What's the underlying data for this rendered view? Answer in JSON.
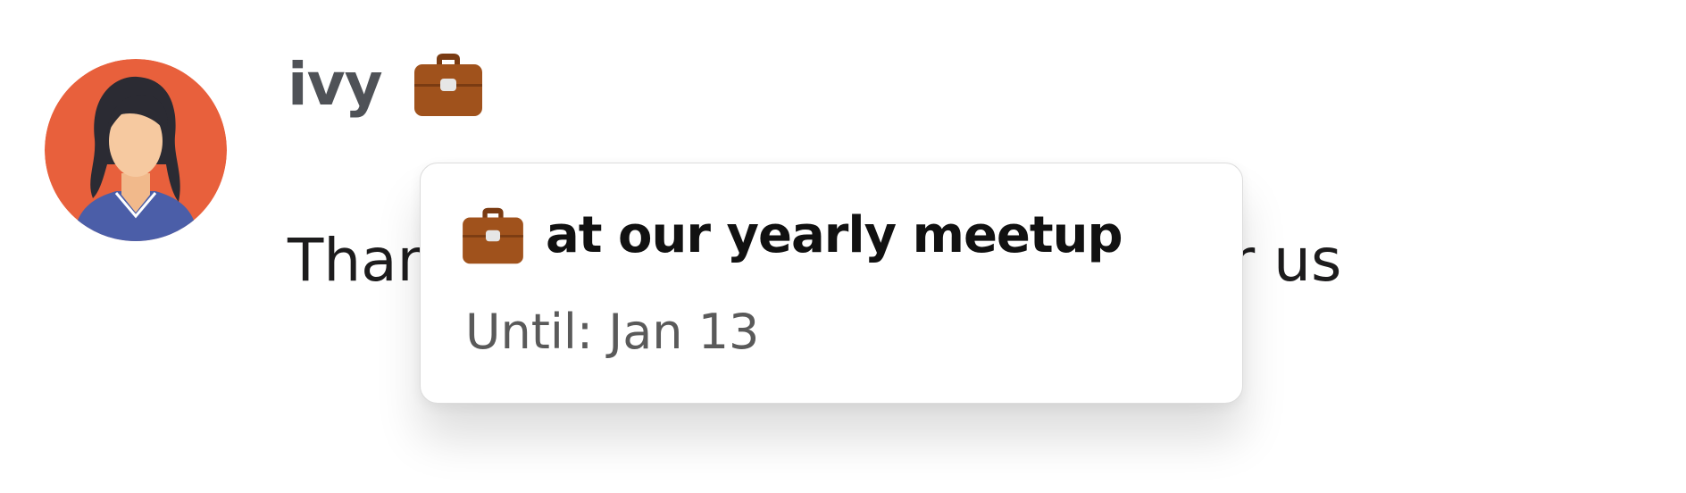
{
  "message": {
    "author": "ivy",
    "status_emoji": "briefcase-icon",
    "text": "Thanks for everything you do for us"
  },
  "status_tooltip": {
    "emoji": "briefcase-icon",
    "title": "at our yearly meetup",
    "until": "Until: Jan 13"
  },
  "colors": {
    "avatar_background": "#e8603c",
    "briefcase": "#a0521c",
    "author_name": "#4f5257",
    "message_text": "#1d1c1d",
    "tooltip_title": "#111111",
    "tooltip_subtext": "#5a5a5a"
  }
}
